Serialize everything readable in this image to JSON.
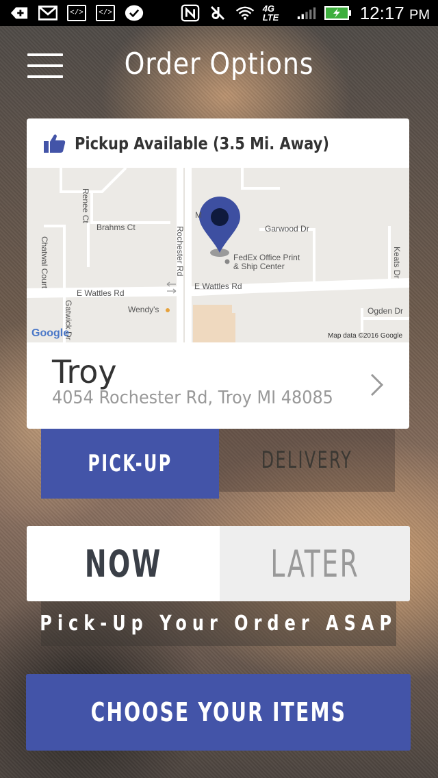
{
  "status_bar": {
    "time": "12:17",
    "ampm": "PM",
    "network": "4G LTE",
    "icons": [
      "add-icon",
      "gmail-icon",
      "code-icon",
      "code-icon",
      "check-badge-icon",
      "nfc-icon",
      "mute-icon",
      "wifi-icon",
      "signal-icon",
      "battery-charging-icon"
    ]
  },
  "header": {
    "title": "Order Options",
    "menu_icon": "hamburger-menu-icon"
  },
  "store_card": {
    "availability": "Pickup Available (3.5 Mi. Away)",
    "availability_icon": "thumbs-up-icon",
    "store_name": "Troy",
    "store_address": "4054 Rochester Rd, Troy MI 48085",
    "map": {
      "labels": {
        "renee_ct": "Renee Ct",
        "brahms_ct": "Brahms Ct",
        "chatwal_court": "Chatwal Court",
        "rochester_rd": "Rochester Rd",
        "garwood_dr": "Garwood Dr",
        "keats_dr": "Keats Dr",
        "fedex_line1": "FedEx Office Print",
        "fedex_line2": "& Ship Center",
        "e_wattles_left": "E Wattles Rd",
        "e_wattles_right": "E Wattles Rd",
        "wendys": "Wendy's",
        "gatwick_dr": "Gatwick Dr",
        "ogden_dr": "Ogden Dr",
        "m_partial": "M",
        "google": "Google",
        "attribution": "Map data ©2016 Google"
      },
      "pin_color": "#3d4fa1"
    }
  },
  "order_type": {
    "pickup_label": "PICK-UP",
    "delivery_label": "DELIVERY",
    "selected": "pickup"
  },
  "timing": {
    "now_label": "NOW",
    "later_label": "LATER",
    "selected": "now",
    "message": "Pick-Up Your Order ASAP"
  },
  "cta": {
    "label": "CHOOSE YOUR ITEMS"
  },
  "colors": {
    "accent": "#4354a8",
    "white": "#ffffff"
  }
}
